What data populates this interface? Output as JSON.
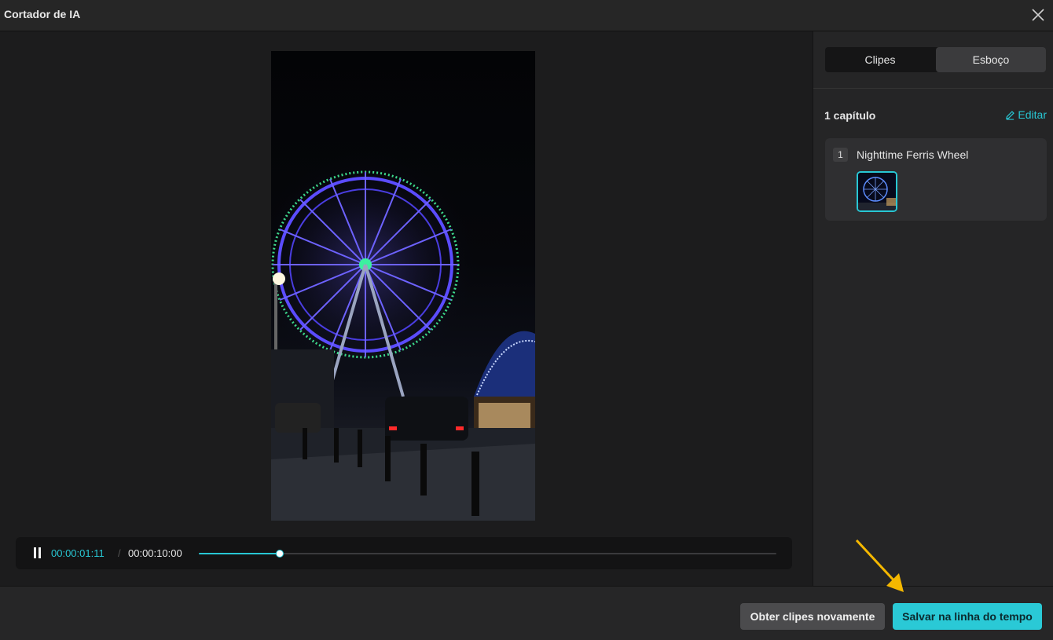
{
  "window": {
    "title": "Cortador de IA"
  },
  "player": {
    "current_time": "00:00:01:11",
    "separator": "/",
    "total_time": "00:00:10:00",
    "progress_fraction": 0.14
  },
  "tabs": [
    {
      "label": "Clipes",
      "active": false
    },
    {
      "label": "Esboço",
      "active": true
    }
  ],
  "chapters": {
    "count_label": "1 capítulo",
    "edit_label": "Editar",
    "items": [
      {
        "number": "1",
        "title": "Nighttime Ferris Wheel"
      }
    ]
  },
  "footer": {
    "regenerate_label": "Obter clipes novamente",
    "save_label": "Salvar na linha do tempo"
  },
  "colors": {
    "accent": "#2ac9d6",
    "annotation_arrow": "#f5b800"
  },
  "icons": [
    "close-icon",
    "pause-icon",
    "pencil-icon",
    "arrow-annotation-icon"
  ]
}
